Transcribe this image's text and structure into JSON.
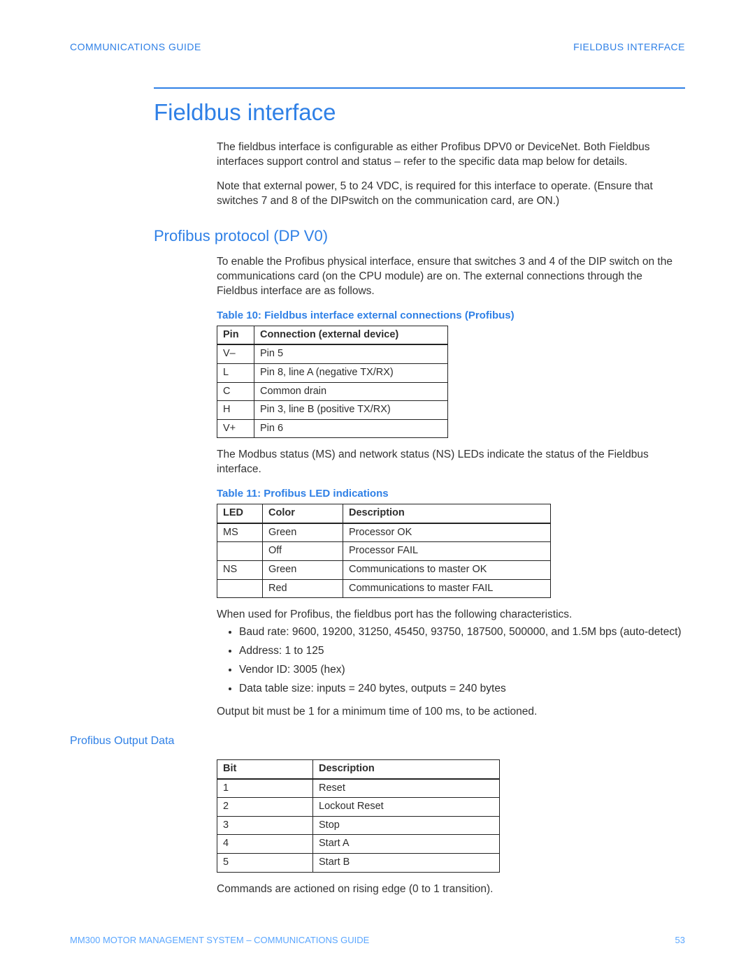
{
  "header": {
    "left": "COMMUNICATIONS GUIDE",
    "right": "FIELDBUS INTERFACE"
  },
  "title": "Fieldbus interface",
  "intro": {
    "p1": "The fieldbus interface is configurable as either Profibus DPV0 or DeviceNet. Both Fieldbus interfaces support control and status – refer to the specific data map below for details.",
    "p2": "Note that external power,  5 to 24 VDC, is required for this interface to operate. (Ensure that switches 7 and 8 of the DIPswitch on the communication card, are ON.)"
  },
  "profibus": {
    "heading": "Profibus protocol (DP V0)",
    "p1": "To enable the Profibus physical interface, ensure that switches 3 and 4 of the DIP switch on the communications card (on the CPU module) are on. The external connections through the Fieldbus interface are as follows.",
    "table10": {
      "caption": "Table 10: Fieldbus interface external connections (Profibus)",
      "headers": [
        "Pin",
        "Connection (external device)"
      ],
      "rows": [
        [
          "V–",
          "Pin 5"
        ],
        [
          "L",
          "Pin 8, line A (negative TX/RX)"
        ],
        [
          "C",
          "Common drain"
        ],
        [
          "H",
          "Pin 3, line B (positive TX/RX)"
        ],
        [
          "V+",
          "Pin 6"
        ]
      ]
    },
    "p2": "The Modbus status (MS) and network status (NS) LEDs indicate the status of the Fieldbus interface.",
    "table11": {
      "caption": "Table 11: Profibus LED indications",
      "headers": [
        "LED",
        "Color",
        "Description"
      ],
      "rows": [
        [
          "MS",
          "Green",
          "Processor OK"
        ],
        [
          "",
          "Off",
          "Processor FAIL"
        ],
        [
          "NS",
          "Green",
          "Communications to master OK"
        ],
        [
          "",
          "Red",
          "Communications to master FAIL"
        ]
      ]
    },
    "p3": "When used for Profibus, the fieldbus port has the following characteristics.",
    "bullets": [
      "Baud rate: 9600, 19200, 31250, 45450, 93750, 187500, 500000, and 1.5M bps (auto-detect)",
      "Address: 1 to 125",
      "Vendor ID: 3005 (hex)",
      "Data table size: inputs = 240 bytes, outputs = 240 bytes"
    ],
    "p4": "Output bit must be 1 for a minimum time of 100 ms, to be actioned."
  },
  "outputData": {
    "heading": "Profibus Output Data",
    "table": {
      "headers": [
        "Bit",
        "Description"
      ],
      "rows": [
        [
          "1",
          "Reset"
        ],
        [
          "2",
          "Lockout Reset"
        ],
        [
          "3",
          "Stop"
        ],
        [
          "4",
          "Start A"
        ],
        [
          "5",
          "Start B"
        ]
      ]
    },
    "p1": "Commands are actioned on rising edge (0 to 1 transition)."
  },
  "footer": {
    "left": "MM300 MOTOR MANAGEMENT SYSTEM – COMMUNICATIONS GUIDE",
    "right": "53"
  }
}
